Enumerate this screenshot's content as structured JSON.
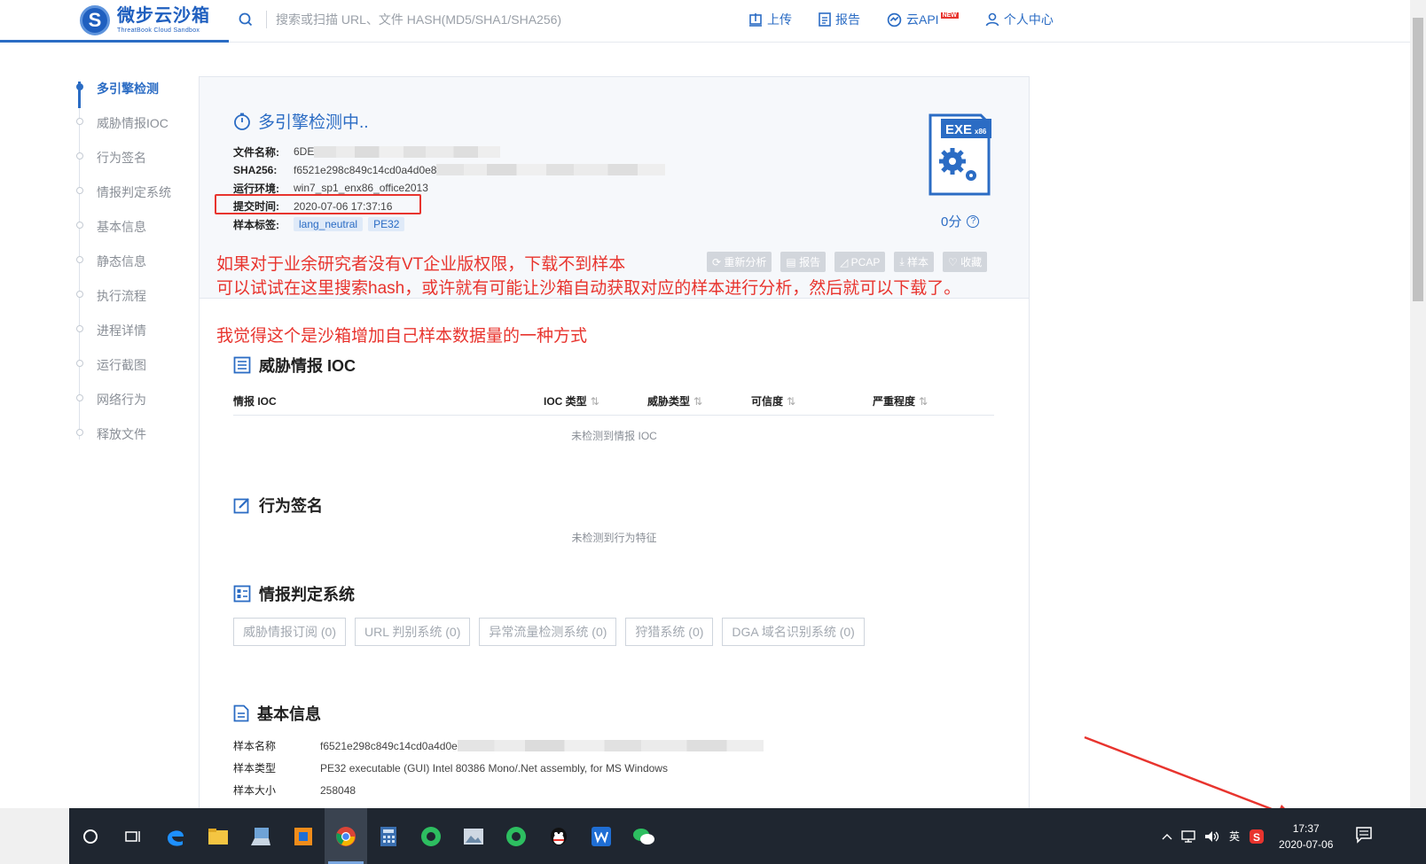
{
  "header": {
    "logo_cn": "微步云沙箱",
    "logo_en": "ThreatBook Cloud Sandbox",
    "search_placeholder": "搜索或扫描 URL、文件 HASH(MD5/SHA1/SHA256)",
    "nav": [
      {
        "label": "上传",
        "icon": "upload-icon"
      },
      {
        "label": "报告",
        "icon": "report-icon"
      },
      {
        "label": "云API",
        "icon": "cloud-api-icon",
        "badge": "NEW"
      },
      {
        "label": "个人中心",
        "icon": "user-icon"
      }
    ]
  },
  "sidebar": {
    "items": [
      {
        "label": "多引擎检测"
      },
      {
        "label": "威胁情报IOC"
      },
      {
        "label": "行为签名"
      },
      {
        "label": "情报判定系统"
      },
      {
        "label": "基本信息"
      },
      {
        "label": "静态信息"
      },
      {
        "label": "执行流程"
      },
      {
        "label": "进程详情"
      },
      {
        "label": "运行截图"
      },
      {
        "label": "网络行为"
      },
      {
        "label": "释放文件"
      }
    ]
  },
  "summary": {
    "status": "多引擎检测中..",
    "rows": [
      {
        "label": "文件名称:",
        "value": "6DE"
      },
      {
        "label": "SHA256:",
        "value": "f6521e298c849c14cd0a4d0e8"
      },
      {
        "label": "运行环境:",
        "value": "win7_sp1_enx86_office2013"
      },
      {
        "label": "提交时间:",
        "value": "2020-07-06 17:37:16"
      },
      {
        "label": "样本标签:",
        "value": ""
      }
    ],
    "tags": [
      "lang_neutral",
      "PE32"
    ],
    "file_type": "EXE",
    "file_arch": "x86",
    "score": "0分",
    "actions": [
      "重新分析",
      "报告",
      "PCAP",
      "样本",
      "收藏"
    ]
  },
  "annotations": {
    "line1": "如果对于业余研究者没有VT企业版权限，下载不到样本",
    "line2": "可以试试在这里搜索hash，或许就有可能让沙箱自动获取对应的样本进行分析，然后就可以下载了。",
    "line3": "我觉得这个是沙箱增加自己样本数据量的一种方式",
    "color": "#e8342e"
  },
  "ioc": {
    "title": "威胁情报 IOC",
    "columns": [
      "情报 IOC",
      "IOC 类型",
      "威胁类型",
      "可信度",
      "严重程度"
    ],
    "empty": "未检测到情报 IOC"
  },
  "behavior": {
    "title": "行为签名",
    "empty": "未检测到行为特征"
  },
  "intel_system": {
    "title": "情报判定系统",
    "systems": [
      "威胁情报订阅 (0)",
      "URL 判别系统 (0)",
      "异常流量检测系统 (0)",
      "狩猎系统 (0)",
      "DGA 域名识别系统 (0)"
    ]
  },
  "basic_info": {
    "title": "基本信息",
    "rows": [
      {
        "label": "样本名称",
        "value": "f6521e298c849c14cd0a4d0e"
      },
      {
        "label": "样本类型",
        "value": "PE32 executable (GUI) Intel 80386 Mono/.Net assembly, for MS Windows"
      },
      {
        "label": "样本大小",
        "value": "258048"
      }
    ]
  },
  "taskbar": {
    "apps": [
      "cortana-icon",
      "task-view-icon",
      "edge-icon",
      "file-explorer-icon",
      "network-app-icon",
      "app-icon",
      "chrome-icon",
      "calculator-icon",
      "evernote-icon",
      "image-viewer-icon",
      "evernote-icon-2",
      "qq-icon",
      "wps-icon",
      "wechat-icon"
    ],
    "ime": "英",
    "time": "17:37",
    "date": "2020-07-06"
  },
  "colors": {
    "accent": "#2b6cc4",
    "annotation": "#e8342e",
    "taskbar": "#1f2630"
  }
}
